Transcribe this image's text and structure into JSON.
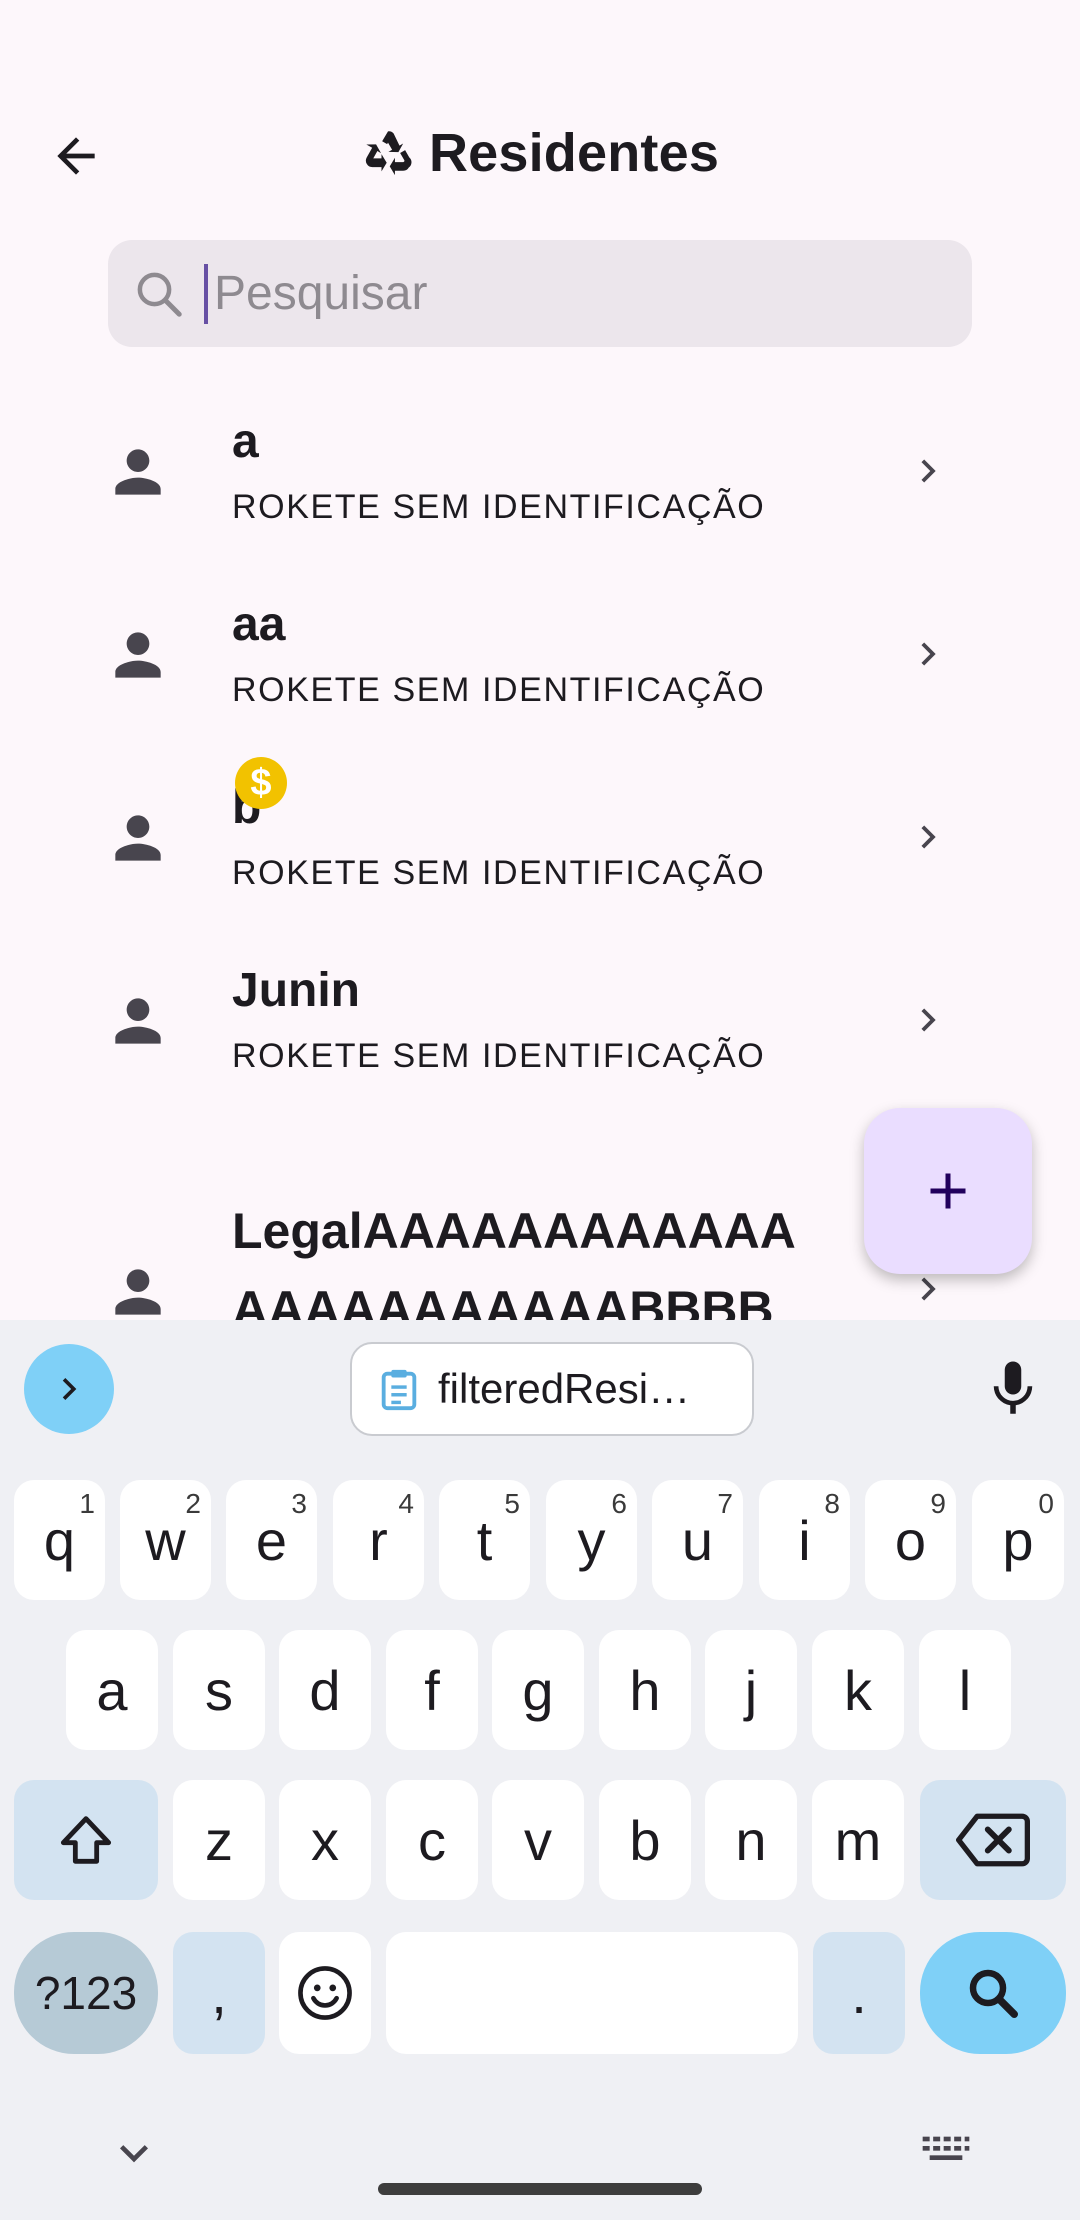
{
  "app": {
    "title": "Residentes"
  },
  "search": {
    "placeholder": "Pesquisar",
    "value": ""
  },
  "residents": [
    {
      "name": "a",
      "subtitle": "ROKETE SEM IDENTIFICAÇÃO"
    },
    {
      "name": "aa",
      "subtitle": "ROKETE SEM IDENTIFICAÇÃO"
    },
    {
      "name": "b",
      "subtitle": "ROKETE SEM IDENTIFICAÇÃO"
    },
    {
      "name": "Junin",
      "subtitle": "ROKETE SEM IDENTIFICAÇÃO"
    },
    {
      "name_line1": "LegalAAAAAAAAAAAA",
      "name_line2": "AAAAAAAAAAABBBB",
      "badge_icon": "dollar-coin-icon"
    }
  ],
  "fab": {
    "icon": "plus-icon"
  },
  "keyboard": {
    "clipboard_suggestion": "filteredResi…",
    "row1": [
      {
        "key": "q",
        "hint": "1"
      },
      {
        "key": "w",
        "hint": "2"
      },
      {
        "key": "e",
        "hint": "3"
      },
      {
        "key": "r",
        "hint": "4"
      },
      {
        "key": "t",
        "hint": "5"
      },
      {
        "key": "y",
        "hint": "6"
      },
      {
        "key": "u",
        "hint": "7"
      },
      {
        "key": "i",
        "hint": "8"
      },
      {
        "key": "o",
        "hint": "9"
      },
      {
        "key": "p",
        "hint": "0"
      }
    ],
    "row2": [
      "a",
      "s",
      "d",
      "f",
      "g",
      "h",
      "j",
      "k",
      "l"
    ],
    "row3": [
      "z",
      "x",
      "c",
      "v",
      "b",
      "n",
      "m"
    ],
    "symbols_label": "?123",
    "comma": ",",
    "period": "."
  },
  "colors": {
    "background": "#fdf7fb",
    "fab": "#eaddff",
    "accent": "#7fd0f7",
    "coin": "#f2c200"
  }
}
